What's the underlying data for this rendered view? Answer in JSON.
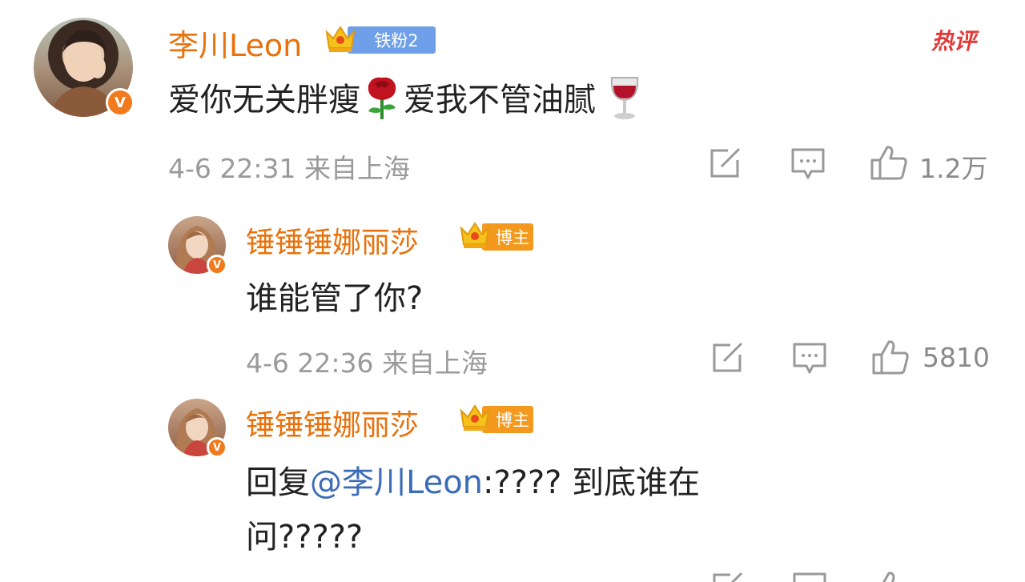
{
  "hot_tag": "热评",
  "comments": [
    {
      "username": "李川Leon",
      "badge": "铁粉2",
      "text_part1": "爱你无关胖瘦",
      "text_part2": "爱我不管油腻",
      "emoji1": "rose",
      "emoji2": "wine-glass",
      "meta": "4-6 22:31 来自上海",
      "likes": "1.2万"
    },
    {
      "username": "锤锤锤娜丽莎",
      "badge": "博主",
      "text": "谁能管了你?",
      "meta": "4-6 22:36 来自上海",
      "likes": "5810"
    },
    {
      "username": "锤锤锤娜丽莎",
      "badge": "博主",
      "reply_prefix": "回复",
      "mention": "@李川Leon",
      "text_line1": ":???? 到底谁在",
      "text_line2": "问?????"
    }
  ],
  "icons": [
    "share-icon",
    "comment-icon",
    "like-icon",
    "verified-icon",
    "crown-icon"
  ],
  "colors": {
    "username": "#e8720c",
    "text": "#222222",
    "meta": "#9a9a9a",
    "mention": "#3b6cb8",
    "badge_fan": "#6f9fe8",
    "badge_blogger": "#f39a1e",
    "hot_tag": "#e23a3a"
  }
}
